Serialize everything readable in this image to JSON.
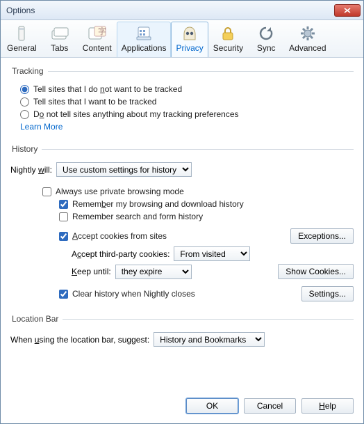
{
  "window": {
    "title": "Options"
  },
  "toolbar": {
    "general": "General",
    "tabs": "Tabs",
    "content": "Content",
    "applications": "Applications",
    "privacy": "Privacy",
    "security": "Security",
    "sync": "Sync",
    "advanced": "Advanced"
  },
  "tracking": {
    "legend": "Tracking",
    "opt1_a": "Tell sites that I do ",
    "opt1_u": "n",
    "opt1_b": "ot want to be tracked",
    "opt2": "Tell sites that I want to be tracked",
    "opt3_a": "D",
    "opt3_u": "o",
    "opt3_b": " not tell sites anything about my tracking preferences",
    "learn_more": "Learn More"
  },
  "history": {
    "legend": "History",
    "will_label_a": "Nightly ",
    "will_label_u": "w",
    "will_label_b": "ill:",
    "will_value": "Use custom settings for history",
    "always_private": "Always use private browsing mode",
    "remember_hist_a": "Remem",
    "remember_hist_u": "b",
    "remember_hist_b": "er my browsing and download history",
    "remember_form": "Remember search and form history",
    "accept_cookies_a": "",
    "accept_cookies_u": "A",
    "accept_cookies_b": "ccept cookies from sites",
    "exceptions": "Exceptions...",
    "third_party_label_a": "A",
    "third_party_label_u": "c",
    "third_party_label_b": "cept third-party cookies:",
    "third_party_value": "From visited",
    "keep_label_a": "",
    "keep_label_u": "K",
    "keep_label_b": "eep until:",
    "keep_value": "they expire",
    "show_cookies": "Show Cookies...",
    "clear_close": "Clear history when Nightly closes",
    "settings": "Settings..."
  },
  "location_bar": {
    "legend": "Location Bar",
    "suggest_label_a": "When ",
    "suggest_label_u": "u",
    "suggest_label_b": "sing the location bar, suggest:",
    "suggest_value": "History and Bookmarks"
  },
  "buttons": {
    "ok": "OK",
    "cancel": "Cancel",
    "help_u": "H",
    "help_b": "elp"
  }
}
